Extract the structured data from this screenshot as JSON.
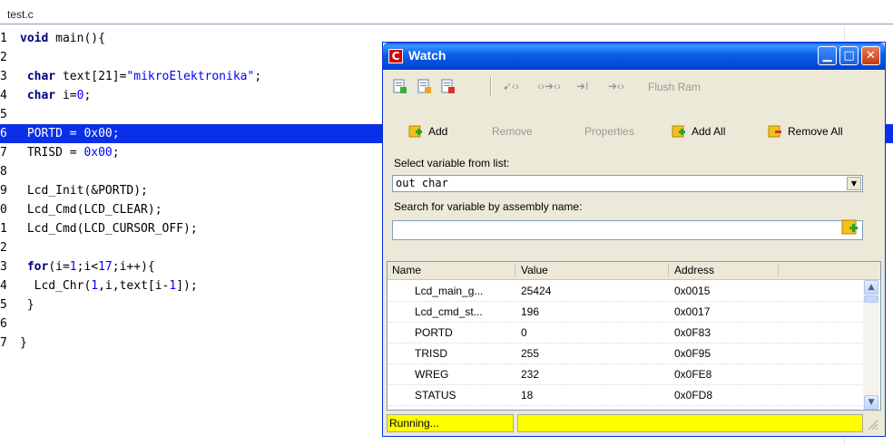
{
  "editor": {
    "tab": "test.c",
    "lines": [
      {
        "n": "1",
        "html": "<span class=\"kw\">void</span> main(){"
      },
      {
        "n": "2",
        "html": ""
      },
      {
        "n": "3",
        "html": " <span class=\"kw\">char</span> text[21]=<span class=\"str\">\"mikroElektronika\"</span>;"
      },
      {
        "n": "4",
        "html": " <span class=\"kw\">char</span> i=<span class=\"num\">0</span>;"
      },
      {
        "n": "5",
        "html": ""
      },
      {
        "n": "6",
        "html": " PORTD = 0x00;",
        "highlight": true
      },
      {
        "n": "7",
        "html": " TRISD = <span class=\"num\">0x00</span>;"
      },
      {
        "n": "8",
        "html": ""
      },
      {
        "n": "9",
        "html": " Lcd_Init(&amp;PORTD);"
      },
      {
        "n": "0",
        "html": " Lcd_Cmd(LCD_CLEAR);"
      },
      {
        "n": "1",
        "html": " Lcd_Cmd(LCD_CURSOR_OFF);"
      },
      {
        "n": "2",
        "html": ""
      },
      {
        "n": "3",
        "html": " <span class=\"kw\">for</span>(i=<span class=\"num\">1</span>;i&lt;<span class=\"num\">17</span>;i++){"
      },
      {
        "n": "4",
        "html": "  Lcd_Chr(<span class=\"num\">1</span>,i,text[i-<span class=\"num\">1</span>]);"
      },
      {
        "n": "5",
        "html": " }"
      },
      {
        "n": "6",
        "html": ""
      },
      {
        "n": "7",
        "html": "}"
      }
    ]
  },
  "watch": {
    "title": "Watch",
    "toolbar": {
      "flush_ram": "Flush Ram"
    },
    "actions": {
      "add": "Add",
      "remove": "Remove",
      "properties": "Properties",
      "add_all": "Add All",
      "remove_all": "Remove All"
    },
    "select_label": "Select variable from list:",
    "select_value": "out char",
    "search_label": "Search for variable by assembly name:",
    "search_value": "",
    "columns": [
      "Name",
      "Value",
      "Address"
    ],
    "rows": [
      {
        "name": "Lcd_main_g...",
        "value": "25424",
        "address": "0x0015"
      },
      {
        "name": "Lcd_cmd_st...",
        "value": "196",
        "address": "0x0017"
      },
      {
        "name": "PORTD",
        "value": "0",
        "address": "0x0F83"
      },
      {
        "name": "TRISD",
        "value": "255",
        "address": "0x0F95"
      },
      {
        "name": "WREG",
        "value": "232",
        "address": "0x0FE8"
      },
      {
        "name": "STATUS",
        "value": "18",
        "address": "0x0FD8"
      }
    ],
    "status": "Running...",
    "status2": ""
  },
  "colors": {
    "highlight": "#0a2fe8",
    "status_bg": "#ffff00",
    "titlebar": "#0a5fe8"
  }
}
